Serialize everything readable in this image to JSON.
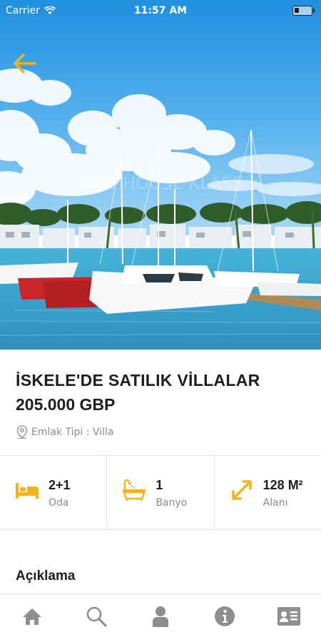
{
  "status_bar": {
    "carrier": "Carrier",
    "time": "11:57 AM"
  },
  "hero": {
    "image_subject": "marina with yachts and villas",
    "watermark": "ERIC HOUSE KLASS"
  },
  "listing": {
    "title": "İSKELE'DE SATILIK VİLLALAR",
    "price": "205.000 GBP",
    "property_type": "Emlak Tipi : Villa"
  },
  "features": [
    {
      "icon": "bed-icon",
      "value": "2+1",
      "label": "Oda"
    },
    {
      "icon": "bathtub-icon",
      "value": "1",
      "label": "Banyo"
    },
    {
      "icon": "area-expand-icon",
      "value": "128 M²",
      "label": "Alanı"
    }
  ],
  "description": {
    "heading": "Açıklama"
  },
  "tab_bar": {
    "items": [
      "home-icon",
      "search-icon",
      "user-icon",
      "info-icon",
      "contact-card-icon"
    ]
  },
  "colors": {
    "accent": "#f6b21b",
    "icon_gray": "#8e8e8e"
  }
}
